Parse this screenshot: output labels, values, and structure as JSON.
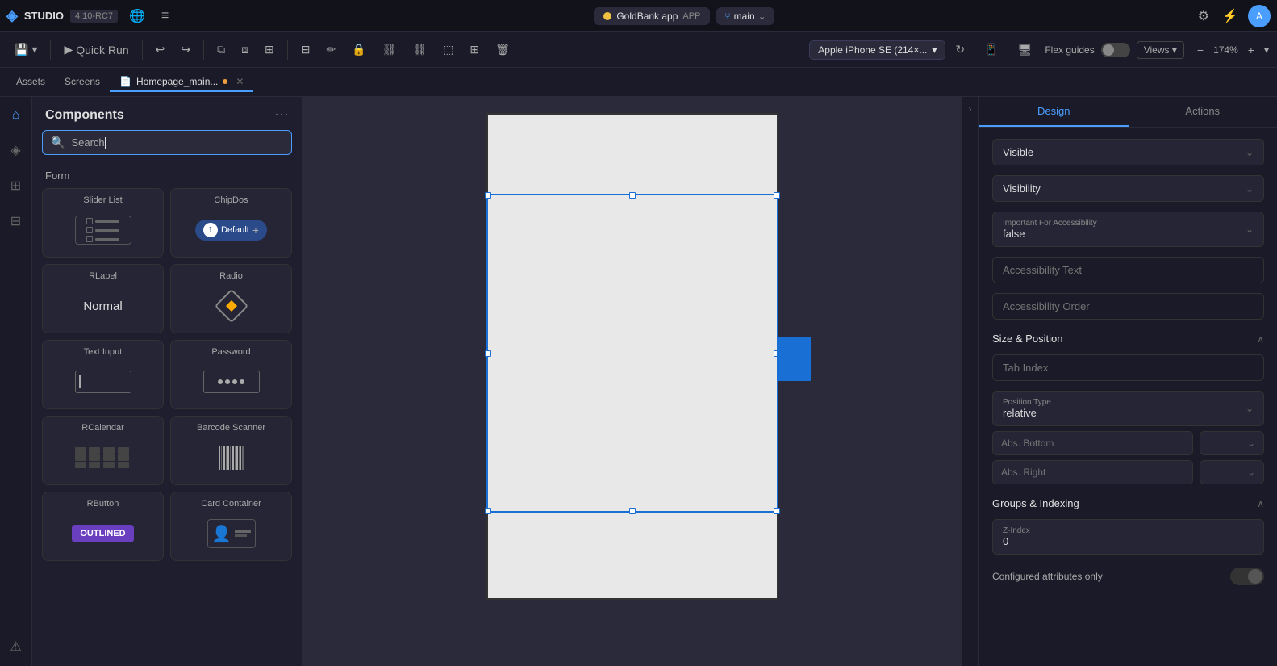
{
  "topbar": {
    "logo": "◈",
    "app_name": "STUDIO",
    "version": "4.10-RC7",
    "globe_icon": "🌐",
    "menu_icon": "≡",
    "project_name": "GoldBank app",
    "project_type": "APP",
    "branch_icon": "⑂",
    "branch_name": "main",
    "branch_arrow": "⌄",
    "plugins_icon": "⚙",
    "lightning_icon": "⚡",
    "avatar_label": "A"
  },
  "toolbar2": {
    "save_icon": "💾",
    "dropdown_icon": "▾",
    "quick_run_label": "Quick Run",
    "undo_icon": "↩",
    "redo_icon": "↪",
    "copy_icon": "⧉",
    "paste_icon": "⧈",
    "multi_icon": "⊞",
    "arrange_icon": "⊟",
    "pen_icon": "✏",
    "lock_icon": "🔒",
    "link_icon": "⛓",
    "link2_icon": "⛓",
    "frame_icon": "⬚",
    "grid_icon": "⊞",
    "trash_icon": "🗑",
    "device_label": "Apple iPhone SE (214×...",
    "refresh_icon": "↻",
    "phone_icon": "📱",
    "monitor_icon": "🖥",
    "flex_guides_label": "Flex guides",
    "views_label": "Views",
    "views_arrow": "▾",
    "zoom_minus": "−",
    "zoom_plus": "+",
    "zoom_level": "174%",
    "zoom_arrow": "▾"
  },
  "tabbar": {
    "assets_tab": "Assets",
    "screens_tab": "Screens",
    "file_tab": "Homepage_main...",
    "file_dot": true
  },
  "sidebar_left": {
    "icons": [
      "⌂",
      "◈",
      "⊞",
      "⊟",
      "⚠"
    ]
  },
  "components": {
    "title": "Components",
    "more_icon": "⋯",
    "search_placeholder": "Search",
    "section_form": "Form",
    "items": [
      {
        "label": "Slider List",
        "type": "slider-list"
      },
      {
        "label": "ChipDos",
        "type": "chip-dos"
      },
      {
        "label": "RLabel",
        "type": "rlabel",
        "preview_text": "Normal"
      },
      {
        "label": "Radio",
        "type": "radio"
      },
      {
        "label": "Text Input",
        "type": "text-input"
      },
      {
        "label": "Password",
        "type": "password"
      },
      {
        "label": "RCalendar",
        "type": "rcalendar"
      },
      {
        "label": "Barcode Scanner",
        "type": "barcode"
      },
      {
        "label": "RButton",
        "type": "rbutton",
        "preview_text": "OUTLINED"
      },
      {
        "label": "Card Container",
        "type": "card-container"
      }
    ]
  },
  "right_panel": {
    "design_tab": "Design",
    "actions_tab": "Actions",
    "visible_label": "Visible",
    "visibility_label": "Visibility",
    "important_for_accessibility_label": "Important For Accessibility",
    "important_for_accessibility_value": "false",
    "accessibility_text_placeholder": "Accessibility Text",
    "accessibility_order_placeholder": "Accessibility Order",
    "size_position_section": "Size & Position",
    "tab_index_placeholder": "Tab Index",
    "position_type_label": "Position Type",
    "position_type_value": "relative",
    "abs_bottom_label": "Abs. Bottom",
    "abs_right_label": "Abs. Right",
    "groups_indexing_section": "Groups & Indexing",
    "z_index_label": "Z-Index",
    "z_index_value": "0",
    "configured_only_label": "Configured attributes only"
  }
}
